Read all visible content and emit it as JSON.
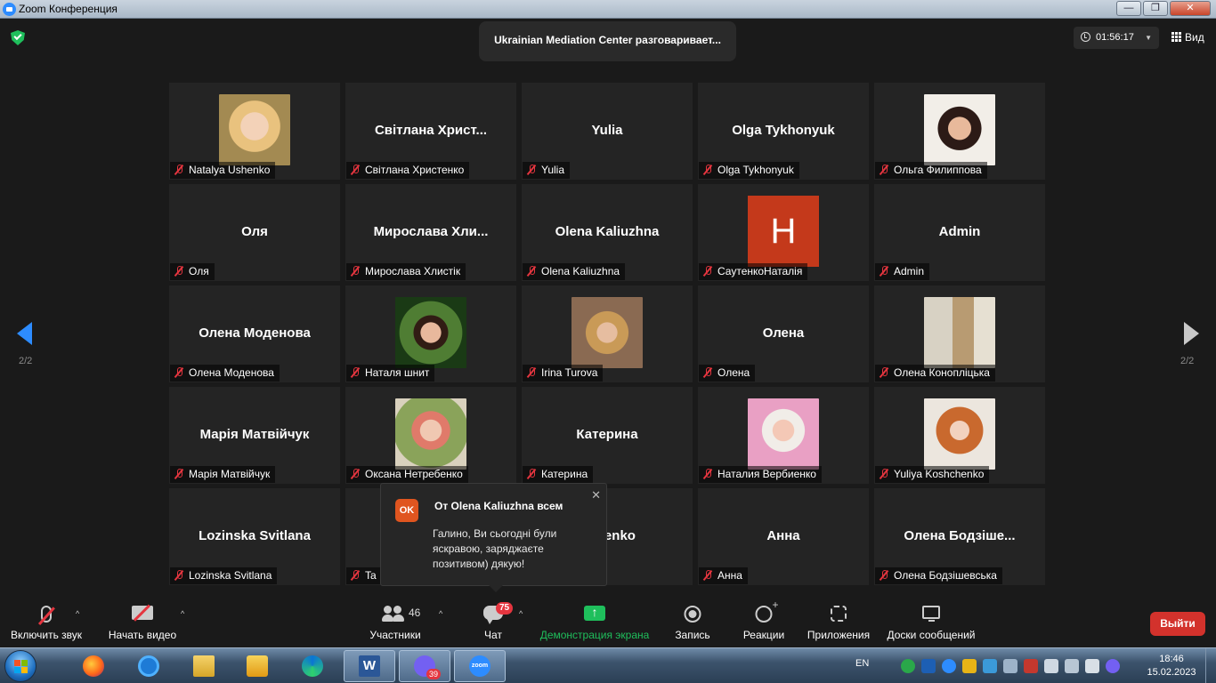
{
  "window": {
    "title": "Zoom Конференция",
    "minimize": "—",
    "maximize": "❐",
    "close": "✕"
  },
  "meeting": {
    "speaker_banner": "Ukrainian Mediation Center разговаривает...",
    "timer": "01:56:17",
    "view_label": "Вид",
    "page_left": "2/2",
    "page_right": "2/2"
  },
  "participants": [
    {
      "label": "Natalya Ushenko",
      "big_name": "",
      "photo": "p1",
      "letter": ""
    },
    {
      "label": "Світлана Христенко",
      "big_name": "Світлана  Христ...",
      "photo": "",
      "letter": ""
    },
    {
      "label": "Yulia",
      "big_name": "Yulia",
      "photo": "",
      "letter": ""
    },
    {
      "label": "Olga Tykhonyuk",
      "big_name": "Olga Tykhonyuk",
      "photo": "",
      "letter": ""
    },
    {
      "label": "Ольга Филиппова",
      "big_name": "",
      "photo": "p2",
      "letter": ""
    },
    {
      "label": "Оля",
      "big_name": "Оля",
      "photo": "",
      "letter": ""
    },
    {
      "label": "Мирослава Хлистік",
      "big_name": "Мирослава  Хли...",
      "photo": "",
      "letter": ""
    },
    {
      "label": "Olena Kaliuzhna",
      "big_name": "Olena Kaliuzhna",
      "photo": "",
      "letter": ""
    },
    {
      "label": "СаутенкоНаталія",
      "big_name": "",
      "photo": "",
      "letter": "H"
    },
    {
      "label": "Admin",
      "big_name": "Admin",
      "photo": "",
      "letter": ""
    },
    {
      "label": "Олена Моденова",
      "big_name": "Олена Моденова",
      "photo": "",
      "letter": ""
    },
    {
      "label": "Наталя шнит",
      "big_name": "",
      "photo": "p3",
      "letter": ""
    },
    {
      "label": "Irina Turova",
      "big_name": "",
      "photo": "p4",
      "letter": ""
    },
    {
      "label": "Олена",
      "big_name": "Олена",
      "photo": "",
      "letter": ""
    },
    {
      "label": "Олена Коноплiцька",
      "big_name": "",
      "photo": "p5",
      "letter": ""
    },
    {
      "label": "Марія Матвійчук",
      "big_name": "Марія Матвійчук",
      "photo": "",
      "letter": ""
    },
    {
      "label": "Оксана Нетребенко",
      "big_name": "",
      "photo": "p6",
      "letter": ""
    },
    {
      "label": "Катерина",
      "big_name": "Катерина",
      "photo": "",
      "letter": ""
    },
    {
      "label": "Наталия Вербиенко",
      "big_name": "",
      "photo": "p7",
      "letter": ""
    },
    {
      "label": "Yuliya Koshchenko",
      "big_name": "",
      "photo": "p8",
      "letter": ""
    },
    {
      "label": "Lozinska Svitlana",
      "big_name": "Lozinska Svitlana",
      "photo": "",
      "letter": ""
    },
    {
      "label": "Ta",
      "big_name": "",
      "photo": "",
      "letter": ""
    },
    {
      "label": "enko",
      "big_name": "Teslenko",
      "photo": "",
      "letter": ""
    },
    {
      "label": "Анна",
      "big_name": "Анна",
      "photo": "",
      "letter": ""
    },
    {
      "label": "Олена Бодзішевська",
      "big_name": "Олена  Бодзіше...",
      "photo": "",
      "letter": ""
    }
  ],
  "chat_popup": {
    "avatar": "OK",
    "from": "От Olena Kaliuzhna всем",
    "message": "Галино, Ви сьогодні були яскравою, заряджаєте позитивом) дякую!",
    "close": "✕"
  },
  "toolbar": {
    "unmute": "Включить звук",
    "start_video": "Начать видео",
    "participants": "Участники",
    "participants_count": "46",
    "chat": "Чат",
    "chat_badge": "75",
    "share": "Демонстрация экрана",
    "record": "Запись",
    "reactions": "Реакции",
    "apps": "Приложения",
    "whiteboards": "Доски сообщений",
    "exit": "Выйти",
    "caret": "^"
  },
  "taskbar": {
    "word_letter": "W",
    "viber_badge": "39",
    "zoom_text": "zoom",
    "lang": "EN",
    "time": "18:46",
    "date": "15.02.2023"
  },
  "colors": {
    "accent_blue": "#2d8cff",
    "share_green": "#1fbf5c",
    "exit_red": "#d3322c",
    "muted_red": "#e5353f"
  }
}
